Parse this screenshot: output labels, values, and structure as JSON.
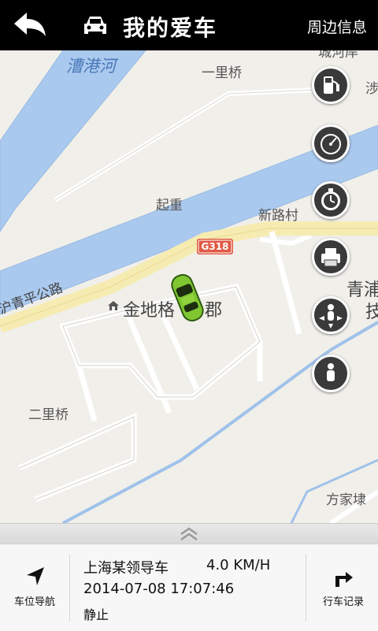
{
  "header": {
    "title": "我的爱车",
    "nearby_label": "周边信息"
  },
  "map": {
    "labels": {
      "river": "漕港河",
      "yilibridge": "一里桥",
      "chengheku": "城河岸",
      "qizhong": "起重",
      "xinlucun": "新路村",
      "road_sign": "G318",
      "jindi": "金地格",
      "jindi_suffix": "郡",
      "huqing_road": "沪青平公路",
      "erlibridge": "二里桥",
      "fangjiadai": "方家埭",
      "qing": "青浦",
      "ji": "技",
      "edge_char": "涉"
    }
  },
  "vehicle": {
    "name": "上海某领导车",
    "speed": "4.0 KM/H",
    "datetime": "2014-07-08 17:07:46",
    "status": "静止"
  },
  "bottom": {
    "nav_label": "车位导航",
    "record_label": "行车记录"
  }
}
